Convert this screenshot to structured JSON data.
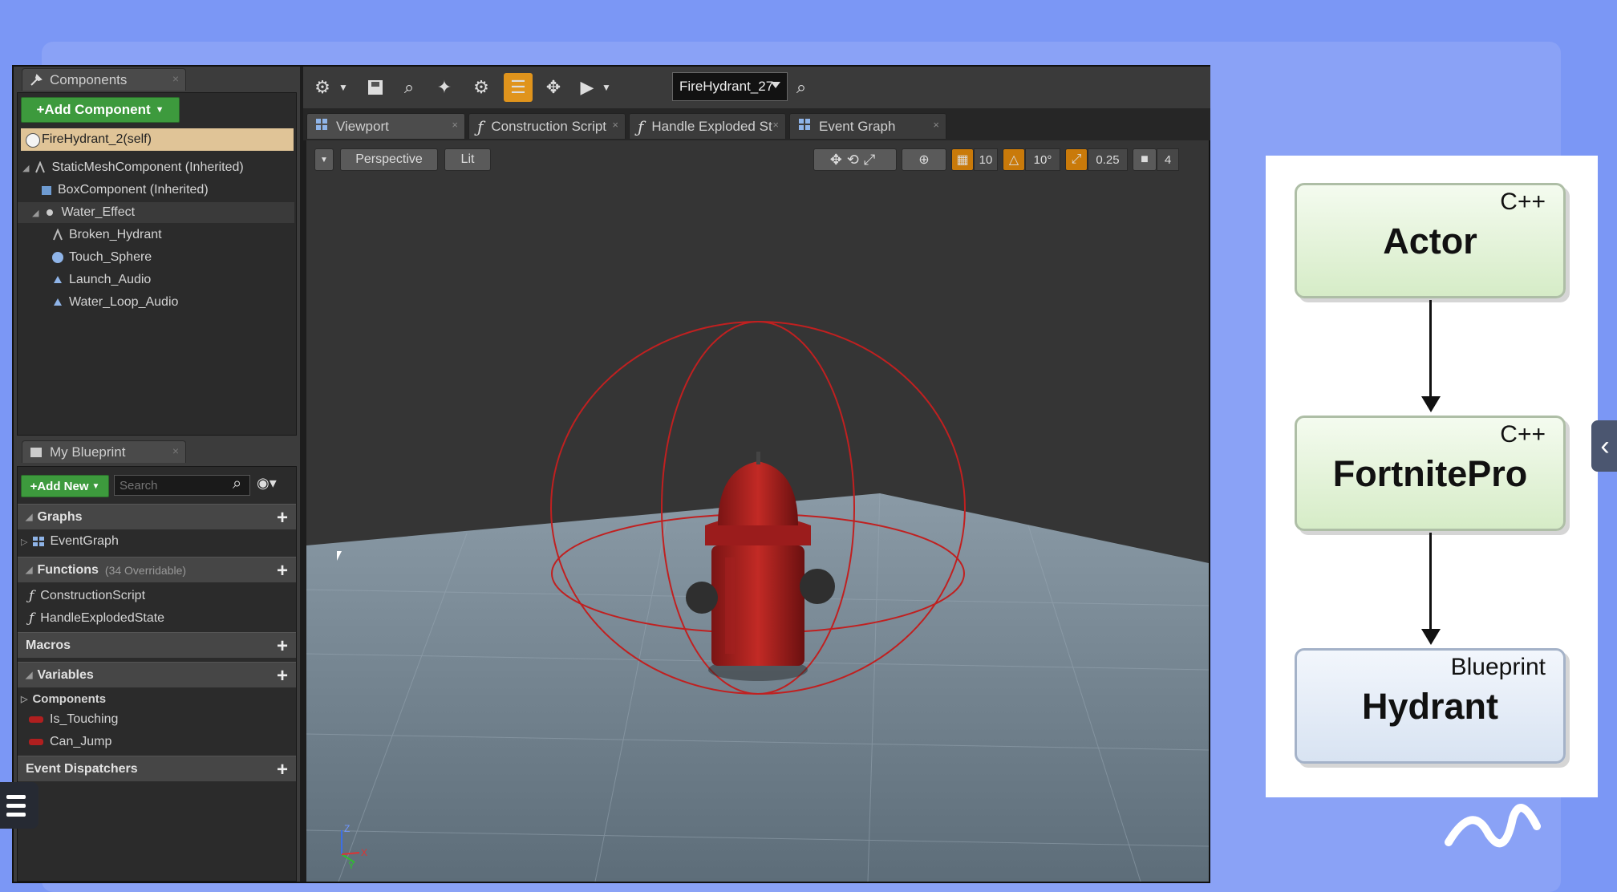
{
  "left_panel": {
    "components_tab": "Components",
    "add_component": "+Add Component",
    "self_item": "FireHydrant_2(self)",
    "tree": [
      "StaticMeshComponent (Inherited)",
      "BoxComponent (Inherited)",
      "Water_Effect",
      "Broken_Hydrant",
      "Touch_Sphere",
      "Launch_Audio",
      "Water_Loop_Audio"
    ],
    "my_blueprint_tab": "My Blueprint",
    "add_new": "+Add New",
    "search_placeholder": "Search",
    "sections": {
      "graphs": "Graphs",
      "event_graph": "EventGraph",
      "functions": "Functions",
      "functions_note": "(34 Overridable)",
      "construction_script": "ConstructionScript",
      "handle_exploded": "HandleExplodedState",
      "macros": "Macros",
      "variables": "Variables",
      "components": "Components",
      "is_touching": "Is_Touching",
      "can_jump": "Can_Jump",
      "event_dispatchers": "Event Dispatchers"
    }
  },
  "toolbar": {
    "debug_object": "FireHydrant_27"
  },
  "editor_tabs": [
    "Viewport",
    "Construction Script",
    "Handle Exploded St",
    "Event Graph"
  ],
  "viewport": {
    "perspective": "Perspective",
    "lit": "Lit",
    "grid_snap": "10",
    "rotation_snap": "10°",
    "scale_snap": "0.25",
    "camera_speed": "4",
    "axis_z": "Z",
    "axis_y": "Y",
    "axis_x": "X"
  },
  "diagram": {
    "nodes": [
      {
        "tag": "C++",
        "name": "Actor"
      },
      {
        "tag": "C++",
        "name": "FortnitePro"
      },
      {
        "tag": "Blueprint",
        "name": "Hydrant"
      }
    ]
  }
}
